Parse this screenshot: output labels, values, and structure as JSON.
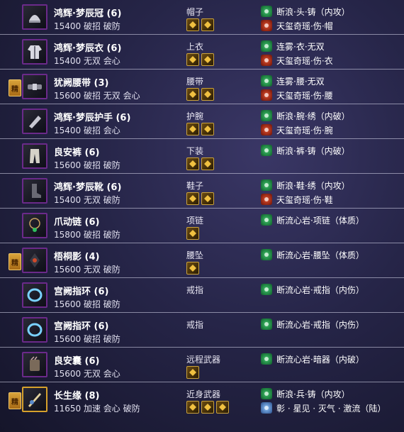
{
  "equipment": [
    {
      "name": "鸿辉·梦辰冠 (6)",
      "attrs": "15400 破招 破防",
      "slot": "帽子",
      "gems": 2,
      "enhancements": [
        {
          "icon": "green-gem-icon",
          "text": "断浪·头·铸（内攻）"
        },
        {
          "icon": "red-enchant-icon",
          "text": "天玺奇瑶·伤·帽"
        }
      ],
      "set_badge": "",
      "icon": "headgear-icon",
      "rarity": "purple"
    },
    {
      "name": "鸿辉·梦辰衣 (6)",
      "attrs": "15400 无双 会心",
      "slot": "上衣",
      "gems": 2,
      "enhancements": [
        {
          "icon": "green-gem-icon",
          "text": "连雾·衣·无双"
        },
        {
          "icon": "red-enchant-icon",
          "text": "天玺奇瑶·伤·衣"
        }
      ],
      "set_badge": "",
      "icon": "robe-icon",
      "rarity": "purple"
    },
    {
      "name": "犹阙腰带 (3)",
      "attrs": "15600 破招 无双 会心",
      "slot": "腰带",
      "gems": 2,
      "enhancements": [
        {
          "icon": "green-gem-icon",
          "text": "连雾·腰·无双"
        },
        {
          "icon": "red-enchant-icon",
          "text": "天玺奇瑶·伤·腰"
        }
      ],
      "set_badge": "精",
      "icon": "belt-icon",
      "rarity": "purple"
    },
    {
      "name": "鸿辉·梦辰护手 (6)",
      "attrs": "15400 破招 会心",
      "slot": "护腕",
      "gems": 2,
      "enhancements": [
        {
          "icon": "green-gem-icon",
          "text": "断浪·腕·绣（内破）"
        },
        {
          "icon": "red-enchant-icon",
          "text": "天玺奇瑶·伤·腕"
        }
      ],
      "set_badge": "",
      "icon": "bracer-icon",
      "rarity": "purple"
    },
    {
      "name": "良安裤 (6)",
      "attrs": "15600 破招 破防",
      "slot": "下装",
      "gems": 2,
      "enhancements": [
        {
          "icon": "green-gem-icon",
          "text": "断浪·裤·铸（内破）"
        }
      ],
      "set_badge": "",
      "icon": "pants-icon",
      "rarity": "purple"
    },
    {
      "name": "鸿辉·梦辰靴 (6)",
      "attrs": "15400 无双 破防",
      "slot": "鞋子",
      "gems": 2,
      "enhancements": [
        {
          "icon": "green-gem-icon",
          "text": "断浪·鞋·绣（内攻）"
        },
        {
          "icon": "red-enchant-icon",
          "text": "天玺奇瑶·伤·鞋"
        }
      ],
      "set_badge": "",
      "icon": "boots-icon",
      "rarity": "purple"
    },
    {
      "name": "爪动链 (6)",
      "attrs": "15800 破招 破防",
      "slot": "项链",
      "gems": 1,
      "enhancements": [
        {
          "icon": "green-gem-icon",
          "text": "断流心岩·项链（体质）"
        }
      ],
      "set_badge": "",
      "icon": "necklace-icon",
      "rarity": "purple"
    },
    {
      "name": "梧桐影 (4)",
      "attrs": "15600 无双 破防",
      "slot": "腰坠",
      "gems": 1,
      "enhancements": [
        {
          "icon": "green-gem-icon",
          "text": "断流心岩·腰坠（体质）"
        }
      ],
      "set_badge": "精",
      "icon": "pendant-icon",
      "rarity": "purple"
    },
    {
      "name": "宫阙指环 (6)",
      "attrs": "15600 破招 破防",
      "slot": "戒指",
      "gems": 0,
      "enhancements": [
        {
          "icon": "green-gem-icon",
          "text": "断流心岩·戒指（内伤）"
        }
      ],
      "set_badge": "",
      "icon": "ring-icon",
      "rarity": "purple"
    },
    {
      "name": "宫阙指环 (6)",
      "attrs": "15600 破招 破防",
      "slot": "戒指",
      "gems": 0,
      "enhancements": [
        {
          "icon": "green-gem-icon",
          "text": "断流心岩·戒指（内伤）"
        }
      ],
      "set_badge": "",
      "icon": "ring-icon",
      "rarity": "purple"
    },
    {
      "name": "良安囊 (6)",
      "attrs": "15600 无双 会心",
      "slot": "远程武器",
      "gems": 1,
      "enhancements": [
        {
          "icon": "green-gem-icon",
          "text": "断流心岩·暗器（内破）"
        }
      ],
      "set_badge": "",
      "icon": "quiver-icon",
      "rarity": "purple"
    },
    {
      "name": "长生缘 (8)",
      "attrs": "11650 加速 会心 破防",
      "slot": "近身武器",
      "gems": 3,
      "enhancements": [
        {
          "icon": "green-gem-icon",
          "text": "断浪·兵·铸（内攻）"
        },
        {
          "icon": "blue-gem-icon",
          "text": "彰 · 星见 · 灭气 · 激流（陆）"
        }
      ],
      "set_badge": "精",
      "icon": "weapon-icon",
      "rarity": "gold"
    }
  ],
  "colors": {
    "purple": "#6b2a8a",
    "gold": "#d6a12c",
    "green": "#3fc46a",
    "red": "#e2502e"
  }
}
